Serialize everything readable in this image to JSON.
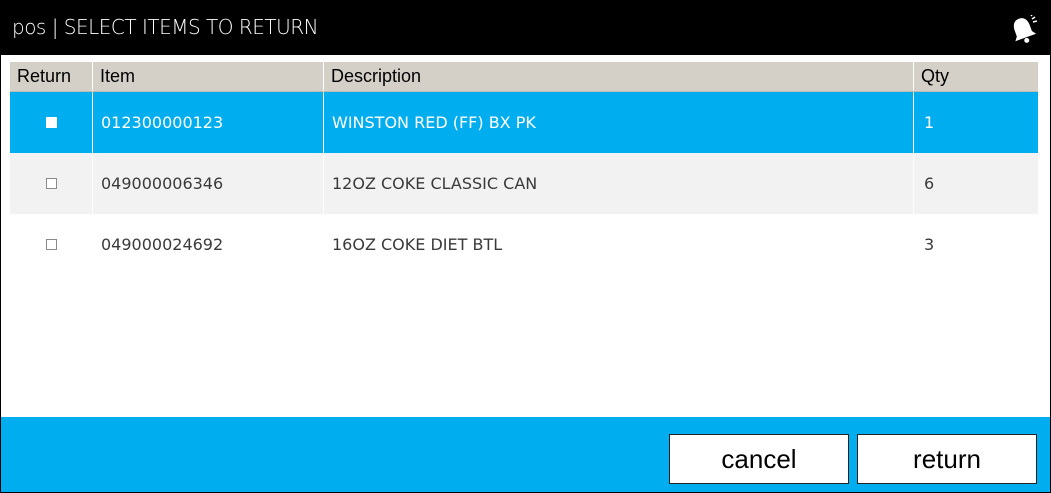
{
  "window": {
    "title": "pos | SELECT ITEMS TO RETURN",
    "notification_icon": "bell-icon"
  },
  "table": {
    "columns": {
      "return": "Return",
      "item": "Item",
      "description": "Description",
      "qty": "Qty"
    },
    "rows": [
      {
        "item": "012300000123",
        "description": "WINSTON RED (FF) BX PK",
        "qty": "1",
        "selected": true,
        "checked": false
      },
      {
        "item": "049000006346",
        "description": "12OZ COKE CLASSIC CAN",
        "qty": "6",
        "selected": false,
        "checked": false
      },
      {
        "item": "049000024692",
        "description": "16OZ COKE DIET BTL",
        "qty": "3",
        "selected": false,
        "checked": false
      }
    ]
  },
  "footer": {
    "cancel_label": "cancel",
    "return_label": "return"
  },
  "colors": {
    "accent": "#00aeef",
    "titlebar": "#000000",
    "header": "#d4d0c8",
    "alt_row": "#f2f2f2"
  }
}
